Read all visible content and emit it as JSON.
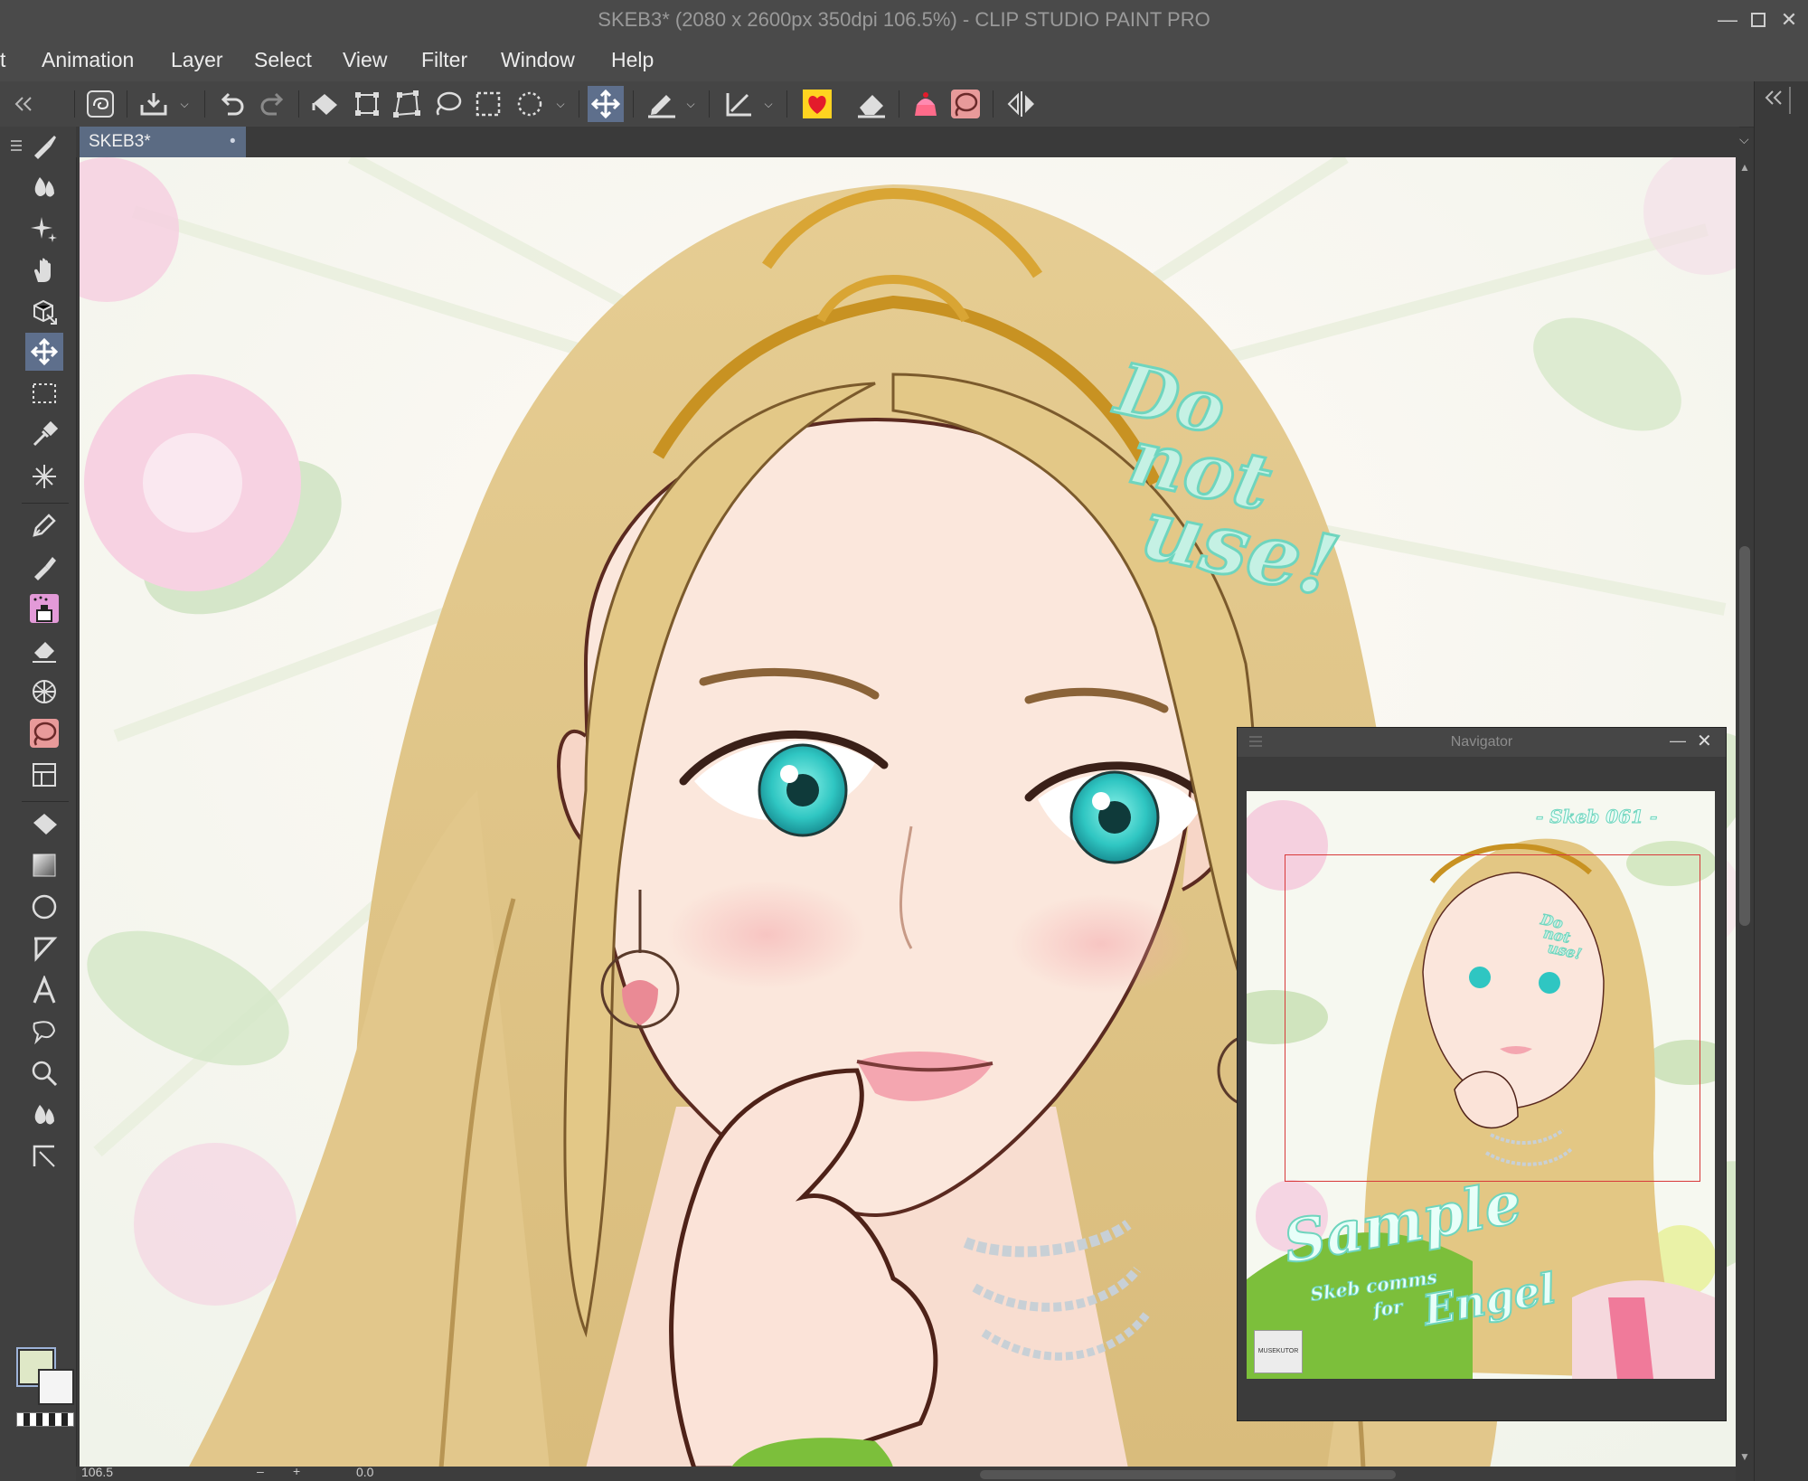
{
  "window": {
    "title": "SKEB3* (2080 x 2600px 350dpi 106.5%)  - CLIP STUDIO PAINT PRO",
    "controls": [
      "minimize",
      "maximize",
      "close"
    ]
  },
  "menu": [
    "t",
    "Animation",
    "Layer",
    "Select",
    "View",
    "Filter",
    "Window",
    "Help"
  ],
  "toolbar": {
    "icons": [
      "collapse-left-icon",
      "clip-studio-logo-icon",
      "save-icon",
      "undo-icon",
      "redo-icon",
      "fill-icon",
      "transform-icon",
      "free-transform-icon",
      "lasso-icon",
      "rect-select-icon",
      "magic-wand-icon",
      "move-icon",
      "pen-icon",
      "ruler-icon",
      "heart-icon",
      "eraser-icon",
      "cake-icon",
      "lasso-fill-icon",
      "flip-horizontal-icon"
    ],
    "active": "move-icon"
  },
  "tools": {
    "items": [
      "brush-icon",
      "blend-icon",
      "sparkle-icon",
      "hand-icon",
      "3d-view-icon",
      "move-layer-icon",
      "selection-rect-icon",
      "eyedropper-icon",
      "auto-select-icon",
      "pen-icon",
      "marker-icon",
      "airbrush-icon",
      "eraser-icon",
      "decoration-icon",
      "lasso-fill-icon",
      "frame-icon",
      "bucket-icon",
      "gradient-icon",
      "ellipse-icon",
      "polyline-icon",
      "text-icon",
      "balloon-icon",
      "zoom-icon",
      "blend-tool-icon",
      "ruler-icon"
    ],
    "active": "move-layer-icon"
  },
  "colors": {
    "main": "#dfe8c7",
    "sub": "#f4f4f4",
    "accent": "#5e6f8c"
  },
  "document_tab": {
    "label": "SKEB3*",
    "modified_dot": "•"
  },
  "canvas": {
    "watermark": [
      "Do",
      "not",
      "use!"
    ]
  },
  "navigator": {
    "title": "Navigator",
    "thumb_label": "- Skeb 061 -",
    "thumb_watermark": [
      "Do",
      "not",
      "use!"
    ],
    "thumb_sample_title": "Sample",
    "thumb_sample_sub": "Skeb comms",
    "thumb_sample_for": "for",
    "thumb_sample_name": "Engel",
    "thumb_logo": "MUSEKUTOR"
  },
  "status": {
    "zoom": "106.5",
    "rotation": "0.0"
  }
}
